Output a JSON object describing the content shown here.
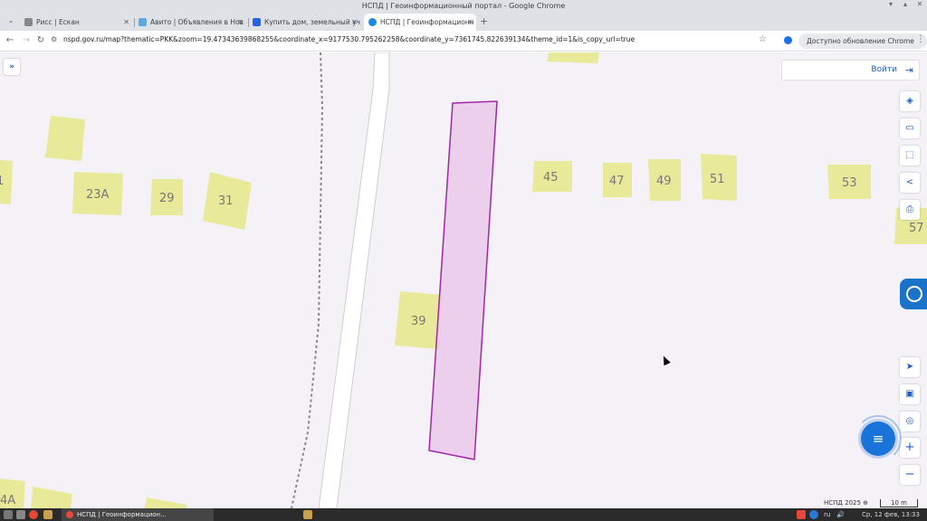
{
  "window": {
    "title": "НСПД | Геоинформационный портал - Google Chrome"
  },
  "tabs": [
    {
      "label": "Рисс | Ескан",
      "color": "#888888"
    },
    {
      "label": "Авито | Объявления в Нов",
      "color": "#5aa9e6"
    },
    {
      "label": "Купить дом, земельный уч",
      "color": "#2563eb"
    },
    {
      "label": "НСПД | Геоинформационн",
      "color": "#1e88e5"
    }
  ],
  "toolbar": {
    "url": "nspd.gov.ru/map?thematic=PKK&zoom=19.47343639868255&coordinate_x=9177530.795262258&coordinate_y=7361745.822639134&theme_id=1&is_copy_url=true",
    "update_label": "Доступно обновление Chrome"
  },
  "map": {
    "login_label": "Войти",
    "buildings": [
      {
        "label": "23А"
      },
      {
        "label": "29"
      },
      {
        "label": "31"
      },
      {
        "label": "39"
      },
      {
        "label": "45"
      },
      {
        "label": "47"
      },
      {
        "label": "49"
      },
      {
        "label": "51"
      },
      {
        "label": "53"
      },
      {
        "label": "57"
      },
      {
        "label": "1"
      },
      {
        "label": "4А"
      }
    ],
    "copyright": "НСПД 2025 ⊕",
    "scale": "10 m",
    "parcel_color": "#e9c9ea",
    "parcel_stroke": "#a326a6",
    "building_color": "#e8ea9a"
  },
  "taskbar": {
    "task_label": "НСПД | Геоинформацион...",
    "lang": "ru",
    "clock": "Ср, 12 фев, 13:33"
  }
}
